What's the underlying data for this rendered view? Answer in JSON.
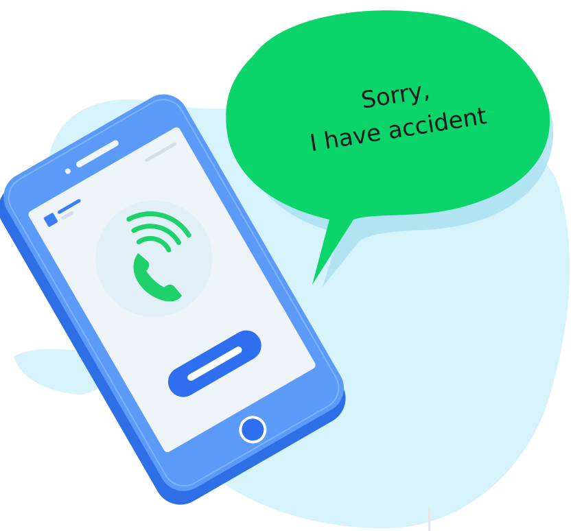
{
  "speech_bubble": {
    "line1": "Sorry,",
    "line2": "I have accident"
  },
  "colors": {
    "background_blob": "#d6f2fb",
    "blob_shadow": "#a9dff0",
    "phone_body": "#3d7ef2",
    "phone_body_light": "#5b9bf7",
    "screen": "#eef3f7",
    "call_circle": "#e1f0f6",
    "call_green": "#1fd16b",
    "bubble_green": "#0ad46a",
    "button_blue": "#2e6ff0"
  },
  "icons": {
    "call": "phone-handset-icon",
    "signal": "signal-waves-icon"
  }
}
